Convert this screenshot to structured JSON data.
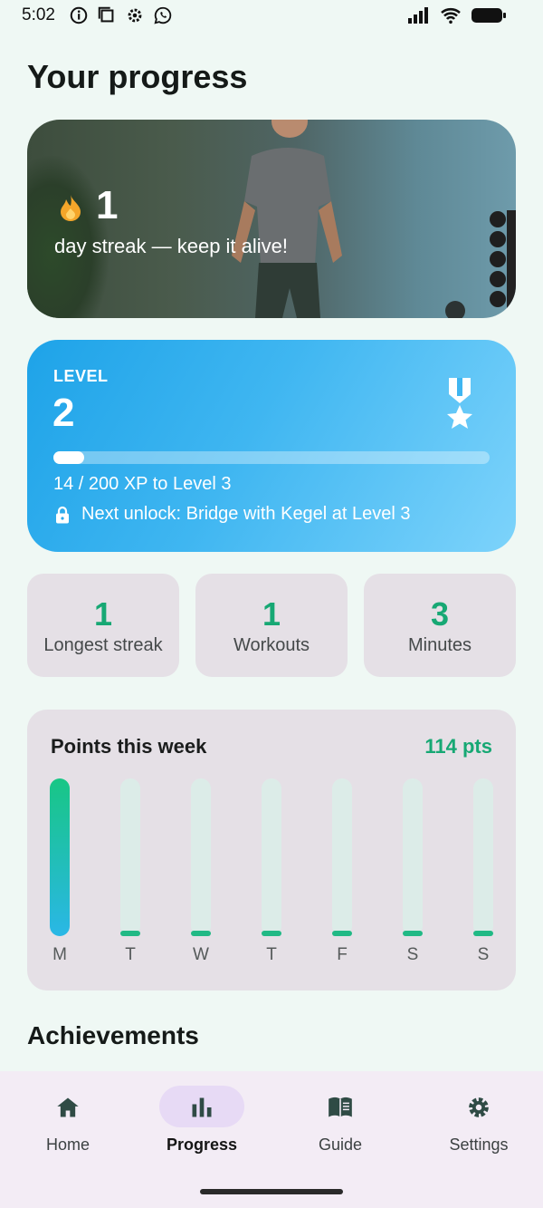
{
  "status_bar": {
    "time": "5:02"
  },
  "page": {
    "title": "Your progress"
  },
  "streak": {
    "count": "1",
    "subtitle": "day streak — keep it alive!"
  },
  "level": {
    "label": "LEVEL",
    "number": "2",
    "xp_text": "14 / 200 XP to Level 3",
    "xp_fraction": 0.07,
    "unlock_text": "Next unlock: Bridge with Kegel at Level 3"
  },
  "stats": [
    {
      "value": "1",
      "label": "Longest streak"
    },
    {
      "value": "1",
      "label": "Workouts"
    },
    {
      "value": "3",
      "label": "Minutes"
    }
  ],
  "weekly": {
    "title": "Points this week",
    "total": "114 pts",
    "days": [
      {
        "label": "M",
        "fraction": 1.0
      },
      {
        "label": "T",
        "fraction": 0
      },
      {
        "label": "W",
        "fraction": 0
      },
      {
        "label": "T",
        "fraction": 0
      },
      {
        "label": "F",
        "fraction": 0
      },
      {
        "label": "S",
        "fraction": 0
      },
      {
        "label": "S",
        "fraction": 0
      }
    ]
  },
  "achievements": {
    "title": "Achievements"
  },
  "nav": {
    "items": [
      {
        "label": "Home",
        "icon": "home-icon"
      },
      {
        "label": "Progress",
        "icon": "bar-chart-icon",
        "active": true
      },
      {
        "label": "Guide",
        "icon": "book-icon"
      },
      {
        "label": "Settings",
        "icon": "gear-icon"
      }
    ]
  },
  "colors": {
    "accent_green": "#17a874",
    "level_blue": "#1ea3e8",
    "flame": "#f4a62a"
  }
}
